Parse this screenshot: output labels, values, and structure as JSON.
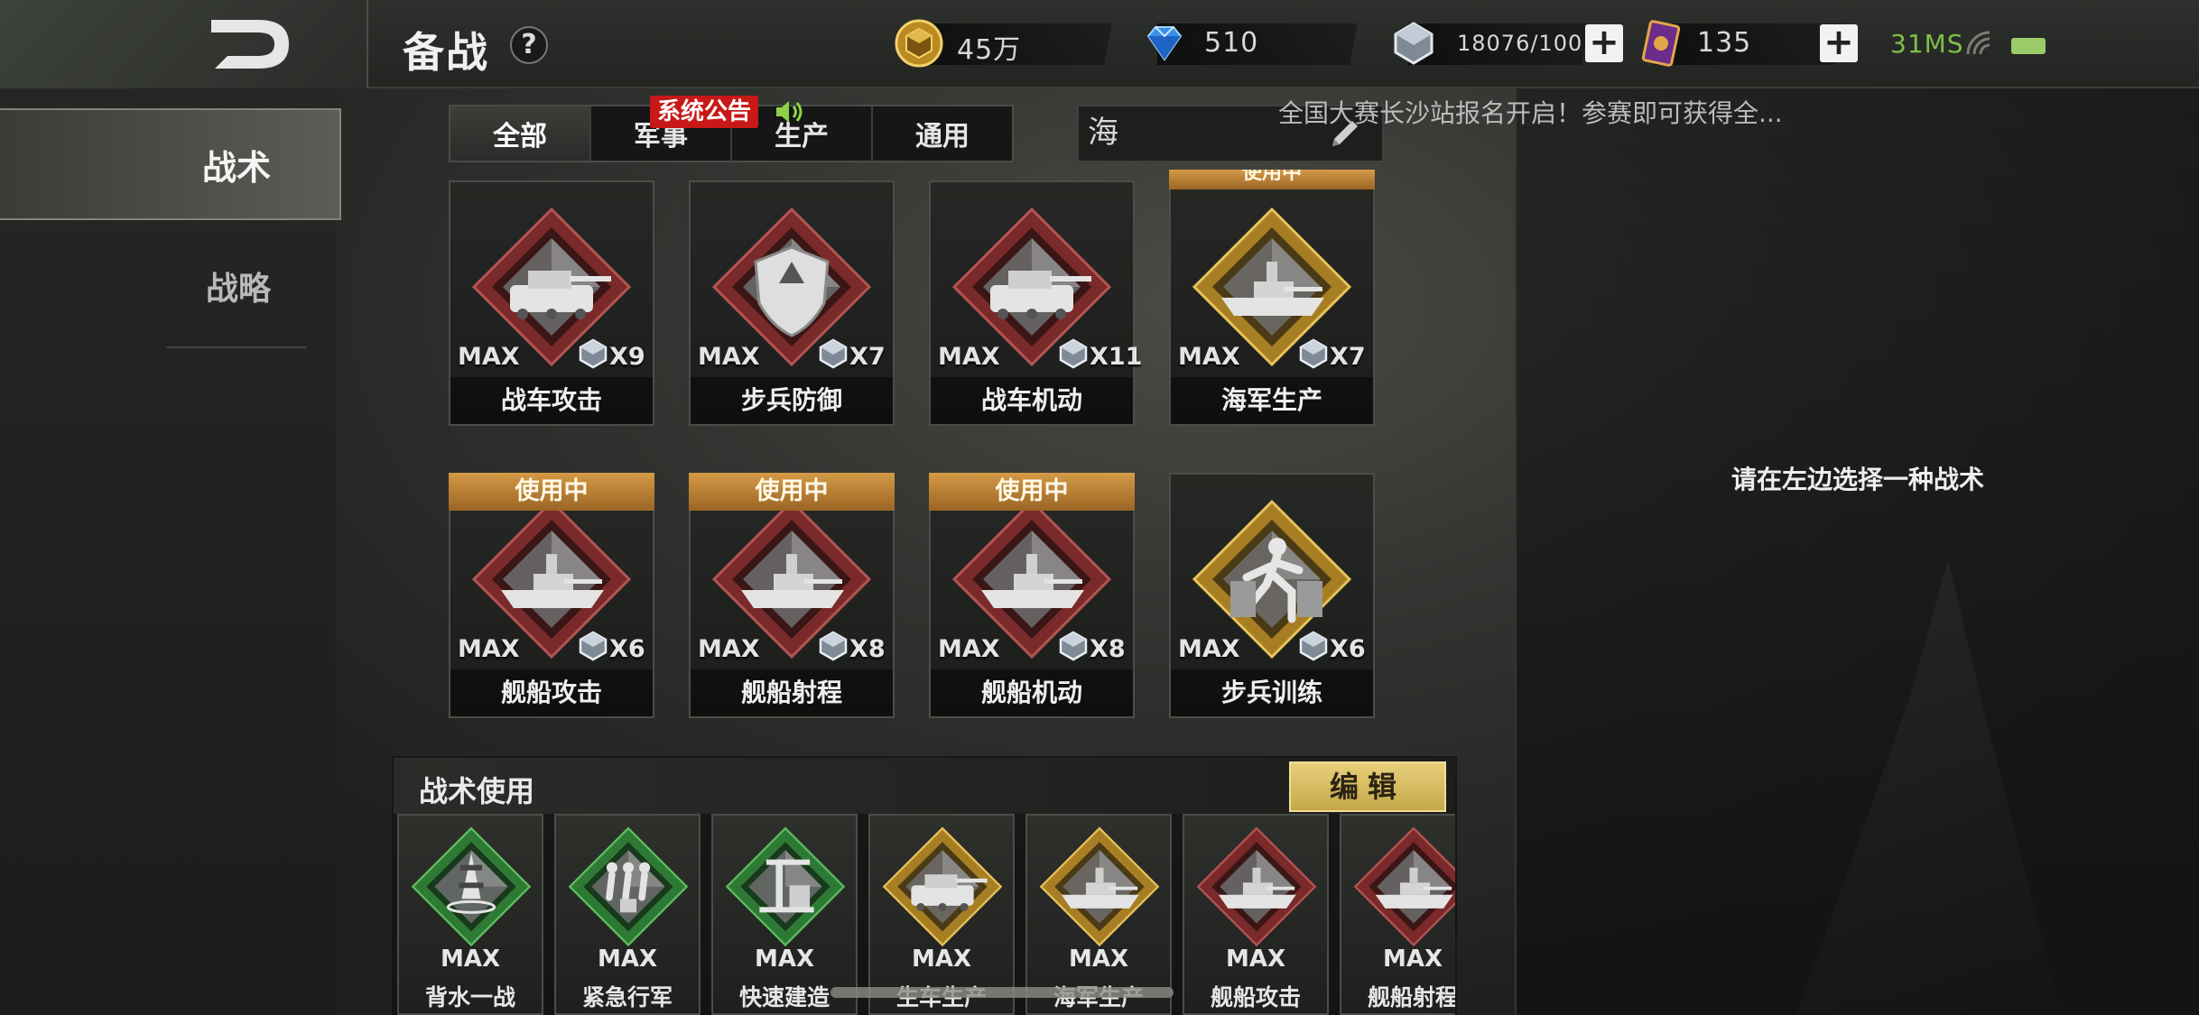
{
  "header": {
    "title": "备战",
    "help": "?",
    "gold": "45万",
    "diamonds": "510",
    "crystals": "18076/100",
    "cards": "135",
    "ping": "31MS"
  },
  "sidebar": {
    "items": [
      {
        "label": "战术",
        "active": true
      },
      {
        "label": "战略",
        "active": false
      }
    ]
  },
  "filters": {
    "tabs": [
      "全部",
      "军事",
      "生产",
      "通用"
    ],
    "active": "全部",
    "search_value": "海"
  },
  "announcement": {
    "tag": "系统公告",
    "text": "全国大赛长沙站报名开启！参赛即可获得全..."
  },
  "in_use_label": "使用中",
  "cards": [
    {
      "name": "战车攻击",
      "level": "MAX",
      "count": "X9",
      "in_use": false,
      "frame": "red"
    },
    {
      "name": "步兵防御",
      "level": "MAX",
      "count": "X7",
      "in_use": false,
      "frame": "red"
    },
    {
      "name": "战车机动",
      "level": "MAX",
      "count": "X11",
      "in_use": false,
      "frame": "red"
    },
    {
      "name": "海军生产",
      "level": "MAX",
      "count": "X7",
      "in_use": true,
      "frame": "gold"
    },
    {
      "name": "舰船攻击",
      "level": "MAX",
      "count": "X6",
      "in_use": true,
      "frame": "red"
    },
    {
      "name": "舰船射程",
      "level": "MAX",
      "count": "X8",
      "in_use": true,
      "frame": "red"
    },
    {
      "name": "舰船机动",
      "level": "MAX",
      "count": "X8",
      "in_use": true,
      "frame": "red"
    },
    {
      "name": "步兵训练",
      "level": "MAX",
      "count": "X6",
      "in_use": false,
      "frame": "gold"
    }
  ],
  "usage": {
    "title": "战术使用",
    "edit_label": "编辑",
    "slots": [
      {
        "name": "背水一战",
        "level": "MAX",
        "frame": "green"
      },
      {
        "name": "紧急行军",
        "level": "MAX",
        "frame": "green"
      },
      {
        "name": "快速建造",
        "level": "MAX",
        "frame": "green"
      },
      {
        "name": "生车生产",
        "level": "MAX",
        "frame": "gold"
      },
      {
        "name": "海军生产",
        "level": "MAX",
        "frame": "gold"
      },
      {
        "name": "舰船攻击",
        "level": "MAX",
        "frame": "red"
      },
      {
        "name": "舰船射程",
        "level": "MAX",
        "frame": "red"
      }
    ]
  },
  "detail": {
    "placeholder": "请在左边选择一种战术"
  },
  "colors": {
    "accent_gold": "#c6a84a",
    "in_use_orange": "#d59a47",
    "notice_red": "#c81818",
    "ping_green": "#7fbf4a"
  }
}
